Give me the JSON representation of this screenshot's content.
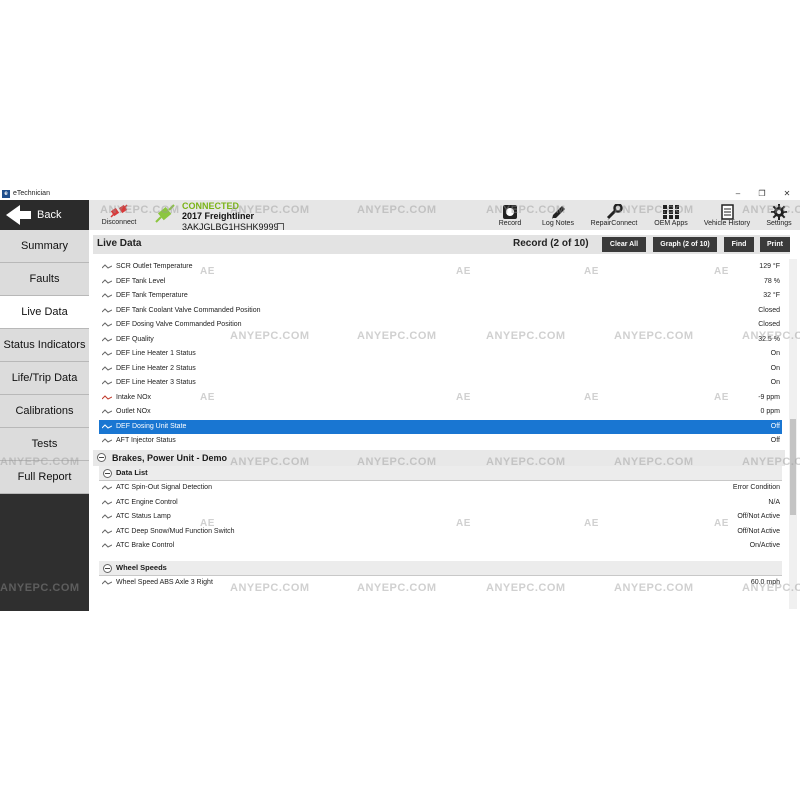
{
  "window": {
    "title": "eTechnician",
    "icon_letter": "e"
  },
  "toolbar": {
    "back_label": "Back",
    "disconnect_label": "Disconnect",
    "connection_status": "CONNECTED",
    "vehicle": "2017 Freightliner",
    "vin": "3AKJGLBG1HSHK9999",
    "tools": [
      {
        "label": "Record",
        "icon": "record-icon"
      },
      {
        "label": "Log Notes",
        "icon": "pencil-icon"
      },
      {
        "label": "RepairConnect",
        "icon": "wrench-icon"
      },
      {
        "label": "OEM Apps",
        "icon": "grid-icon"
      },
      {
        "label": "Vehicle History",
        "icon": "document-icon"
      },
      {
        "label": "Settings",
        "icon": "gear-icon"
      }
    ]
  },
  "sidebar": {
    "items": [
      {
        "label": "Summary"
      },
      {
        "label": "Faults"
      },
      {
        "label": "Live Data",
        "active": true
      },
      {
        "label": "Status Indicators"
      },
      {
        "label": "Life/Trip Data"
      },
      {
        "label": "Calibrations"
      },
      {
        "label": "Tests"
      },
      {
        "label": "Full Report"
      }
    ]
  },
  "main": {
    "title": "Live Data",
    "record_count": "Record (2 of 10)",
    "buttons": {
      "clear_all": "Clear All",
      "graph": "Graph (2 of 10)",
      "find": "Find",
      "print": "Print"
    },
    "rows": [
      {
        "name": "SCR Outlet Temperature",
        "value": "129 °F"
      },
      {
        "name": "DEF Tank Level",
        "value": "78 %"
      },
      {
        "name": "DEF Tank Temperature",
        "value": "32 °F"
      },
      {
        "name": "DEF Tank Coolant Valve Commanded Position",
        "value": "Closed"
      },
      {
        "name": "DEF Dosing Valve Commanded Position",
        "value": "Closed"
      },
      {
        "name": "DEF Quality",
        "value": "32.5 %"
      },
      {
        "name": "DEF Line Heater 1 Status",
        "value": "On"
      },
      {
        "name": "DEF Line Heater 2 Status",
        "value": "On"
      },
      {
        "name": "DEF Line Heater 3 Status",
        "value": "On"
      },
      {
        "name": "Intake NOx",
        "value": "-9 ppm"
      },
      {
        "name": "Outlet NOx",
        "value": "0 ppm"
      },
      {
        "name": "DEF Dosing Unit State",
        "value": "Off",
        "selected": true
      },
      {
        "name": "AFT Injector Status",
        "value": "Off"
      }
    ],
    "group": {
      "title": "Brakes, Power Unit - Demo",
      "subheader": "Data List",
      "rows": [
        {
          "name": "ATC Spin-Out Signal Detection",
          "value": "Error Condition"
        },
        {
          "name": "ATC Engine Control",
          "value": "N/A"
        },
        {
          "name": "ATC Status Lamp",
          "value": "Off/Not Active"
        },
        {
          "name": "ATC Deep Snow/Mud Function Switch",
          "value": "Off/Not Active"
        },
        {
          "name": "ATC Brake Control",
          "value": "On/Active"
        }
      ]
    },
    "group2": {
      "subheader": "Wheel Speeds",
      "rows": [
        {
          "name": "Wheel Speed ABS Axle 3 Right",
          "value": "60.0 mph"
        }
      ]
    }
  },
  "watermark": "ANYEPC.COM",
  "watermark_mark": "AE",
  "colors": {
    "accent": "#1976d2",
    "connected": "#7ab317",
    "sidebar_dark": "#2f2f2f"
  }
}
